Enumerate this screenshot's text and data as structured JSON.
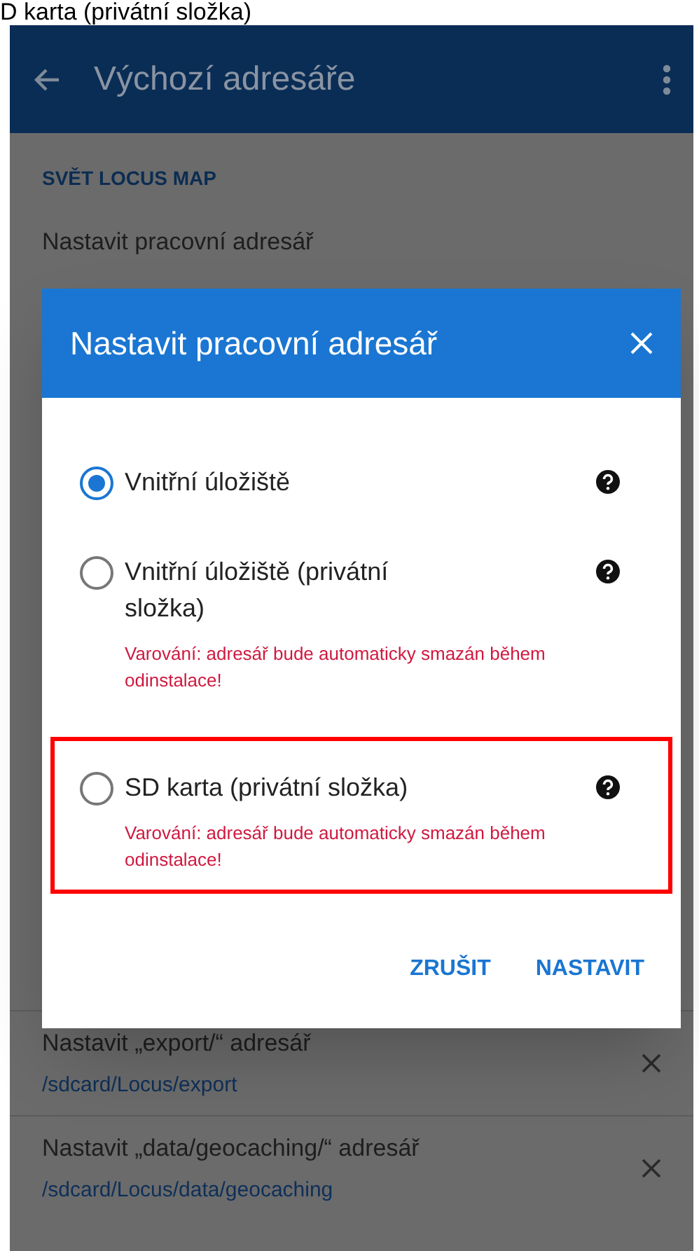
{
  "caption": "D karta (privátní složka)",
  "app_bar": {
    "title": "Výchozí adresáře"
  },
  "section_header": "SVĚT LOCUS MAP",
  "settings": [
    {
      "title": "Nastavit pracovní adresář"
    },
    {
      "title": "Nastavit „export/“ adresář",
      "path": "/sdcard/Locus/export"
    },
    {
      "title": "Nastavit „data/geocaching/“ adresář",
      "path": "/sdcard/Locus/data/geocaching"
    }
  ],
  "dialog": {
    "title": "Nastavit pracovní adresář",
    "options": [
      {
        "label": "Vnitřní úložiště",
        "selected": true,
        "highlighted": false
      },
      {
        "label": "Vnitřní úložiště (privátní složka)",
        "selected": false,
        "highlighted": false,
        "warning": "Varování: adresář bude automaticky smazán během odinstalace!"
      },
      {
        "label": "SD karta (privátní složka)",
        "selected": false,
        "highlighted": true,
        "warning": "Varování: adresář bude automaticky smazán během odinstalace!"
      }
    ],
    "buttons": [
      "ZRUŠIT",
      "NASTAVIT"
    ]
  }
}
